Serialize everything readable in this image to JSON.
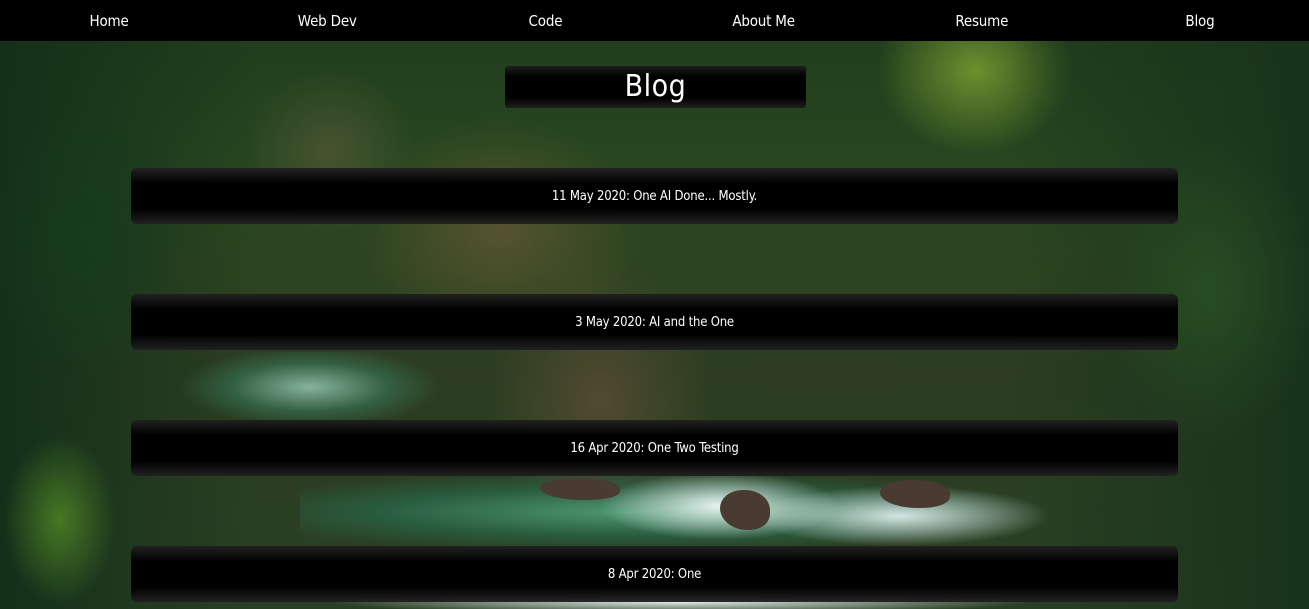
{
  "nav": {
    "items": [
      {
        "label": "Home"
      },
      {
        "label": "Web Dev"
      },
      {
        "label": "Code"
      },
      {
        "label": "About Me"
      },
      {
        "label": "Resume"
      },
      {
        "label": "Blog"
      }
    ]
  },
  "page": {
    "title": "Blog"
  },
  "entries": [
    {
      "label": "11 May 2020: One AI Done... Mostly."
    },
    {
      "label": "3 May 2020: AI and the One"
    },
    {
      "label": "16 Apr 2020: One Two Testing"
    },
    {
      "label": "8 Apr 2020: One"
    }
  ],
  "colors": {
    "nav_background": "#000000",
    "panel_background": "#000000",
    "text": "#ffffff"
  }
}
